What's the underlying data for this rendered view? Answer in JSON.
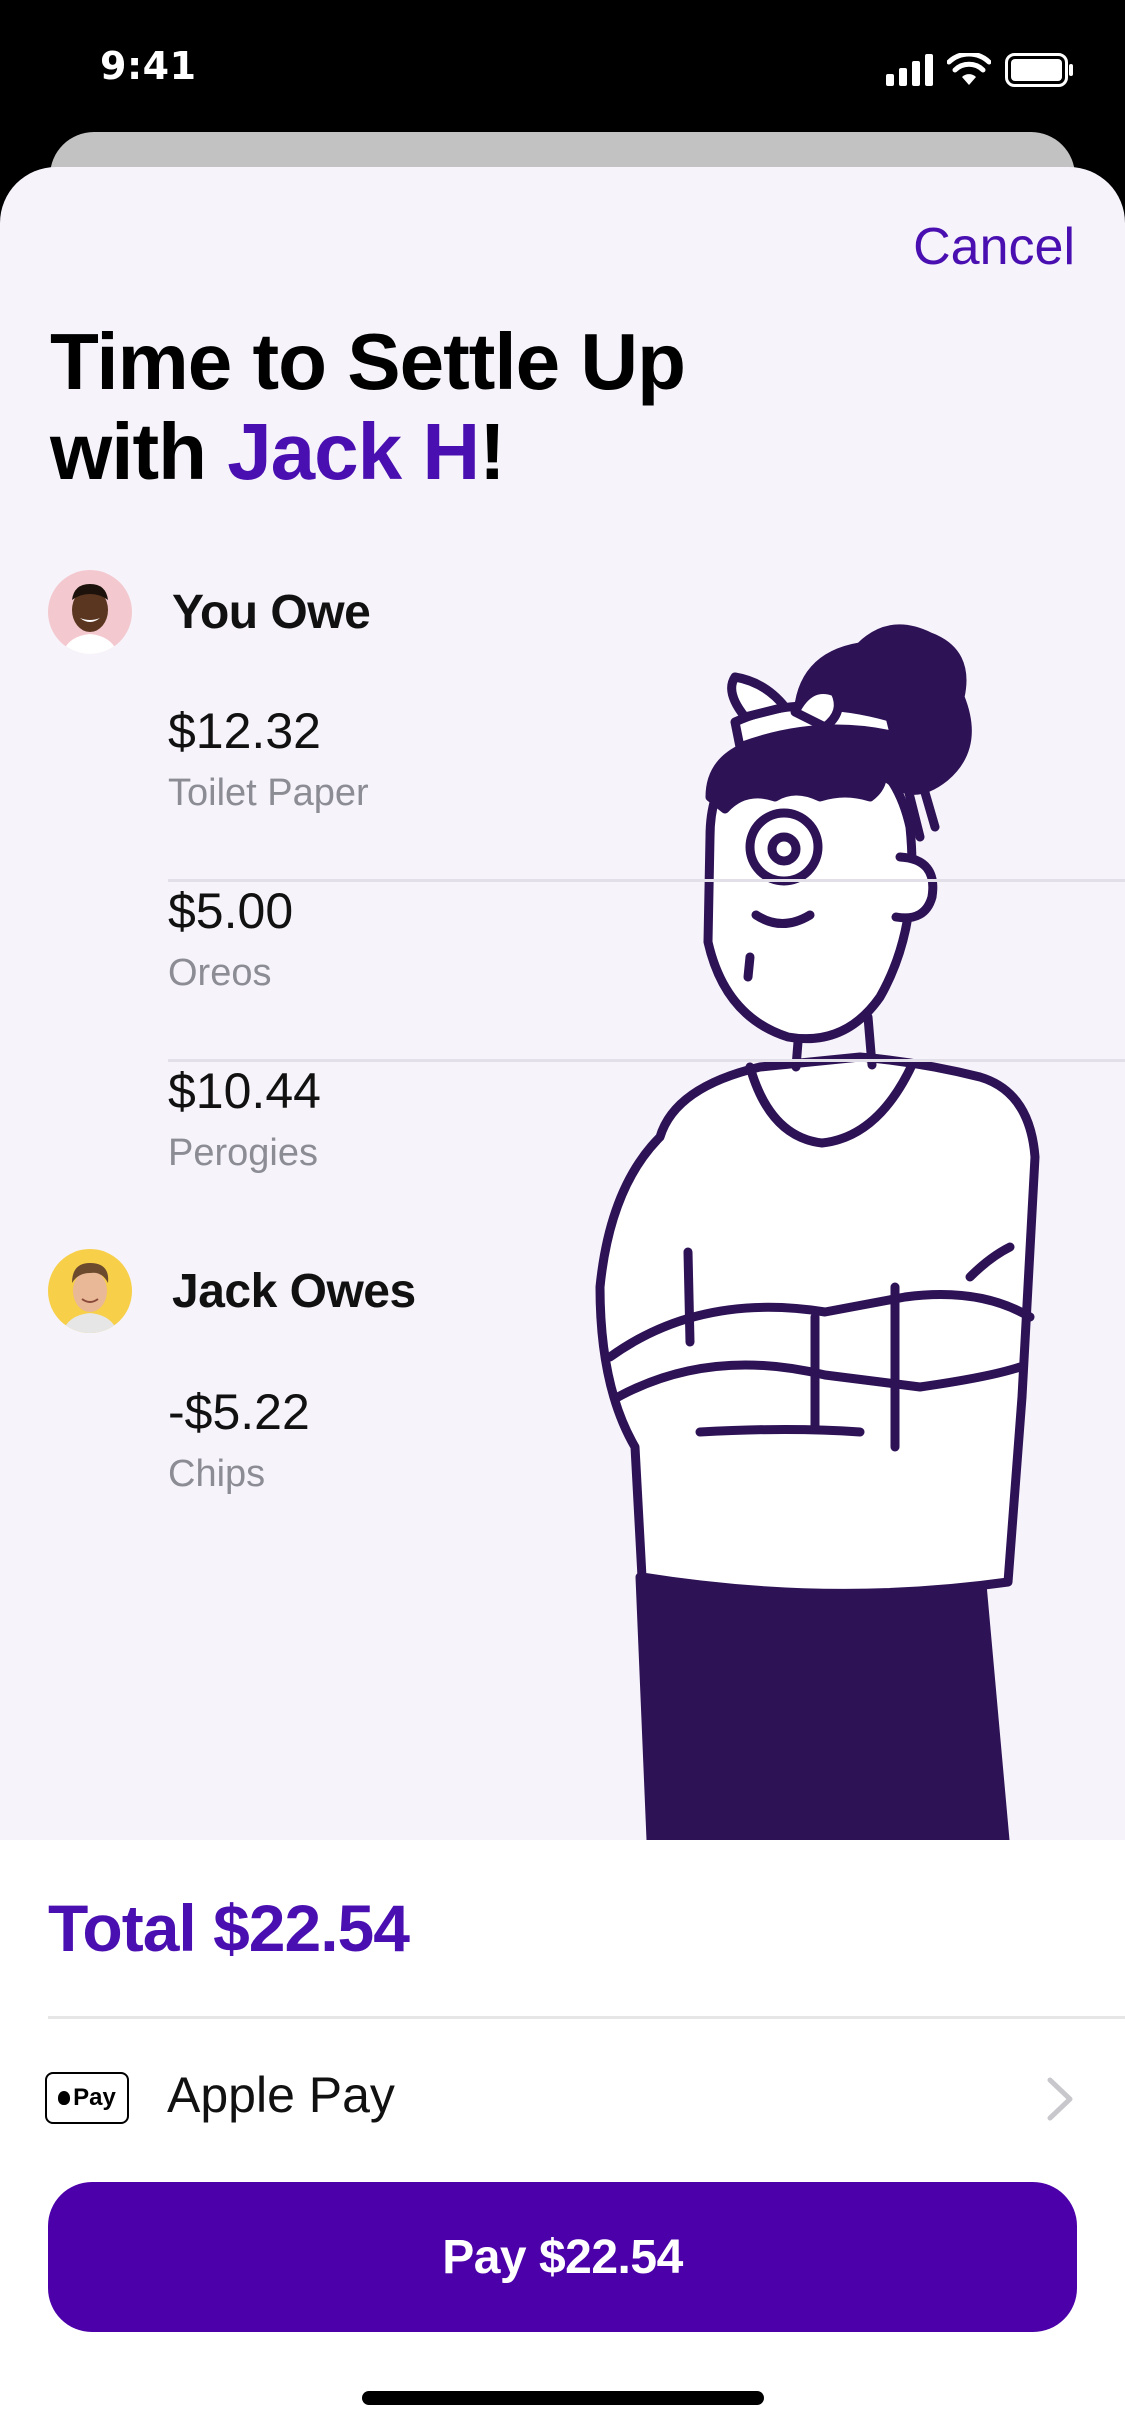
{
  "status_bar": {
    "time": "9:41"
  },
  "header": {
    "cancel_label": "Cancel",
    "title_line1": "Time to Settle Up",
    "title_prefix": "with ",
    "title_name": "Jack H",
    "title_suffix": "!"
  },
  "you_owe": {
    "label": "You Owe",
    "items": [
      {
        "amount": "$12.32",
        "description": "Toilet Paper"
      },
      {
        "amount": "$5.00",
        "description": "Oreos"
      },
      {
        "amount": "$10.44",
        "description": "Perogies"
      }
    ]
  },
  "jack_owes": {
    "label": "Jack Owes",
    "items": [
      {
        "amount": "-$5.22",
        "description": "Chips"
      }
    ]
  },
  "footer": {
    "total_label": "Total $22.54",
    "payment_method": "Apple Pay",
    "applepay_badge_text": "Pay",
    "pay_button_label": "Pay $22.54"
  },
  "colors": {
    "accent": "#4a0fb0",
    "button": "#4b00a9",
    "sheet_background": "#f6f3fa",
    "illustration_ink": "#2e1256"
  },
  "icons": [
    "signal-icon",
    "wifi-icon",
    "battery-icon",
    "chevron-right-icon",
    "apple-pay-icon"
  ]
}
